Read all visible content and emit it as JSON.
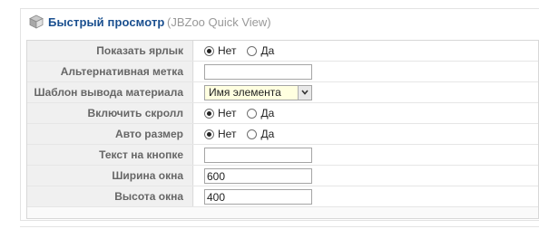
{
  "header": {
    "title": "Быстрый просмотр",
    "subtitle": "(JBZoo Quick View)",
    "icon": "cube-icon"
  },
  "params": [
    {
      "label": "Показать ярлык",
      "type": "radio",
      "options": [
        "Нет",
        "Да"
      ],
      "selected": "Нет"
    },
    {
      "label": "Альтернативная метка",
      "type": "text",
      "value": ""
    },
    {
      "label": "Шаблон вывода материала",
      "type": "select",
      "value": "Имя элемента"
    },
    {
      "label": "Включить скролл",
      "type": "radio",
      "options": [
        "Нет",
        "Да"
      ],
      "selected": "Нет"
    },
    {
      "label": "Авто размер",
      "type": "radio",
      "options": [
        "Нет",
        "Да"
      ],
      "selected": "Нет"
    },
    {
      "label": "Текст на кнопке",
      "type": "text",
      "value": ""
    },
    {
      "label": "Ширина окна",
      "type": "text",
      "value": "600"
    },
    {
      "label": "Высота окна",
      "type": "text",
      "value": "400"
    }
  ],
  "colors": {
    "title": "#1a4f8f",
    "select_bg": "#ffffe0"
  }
}
